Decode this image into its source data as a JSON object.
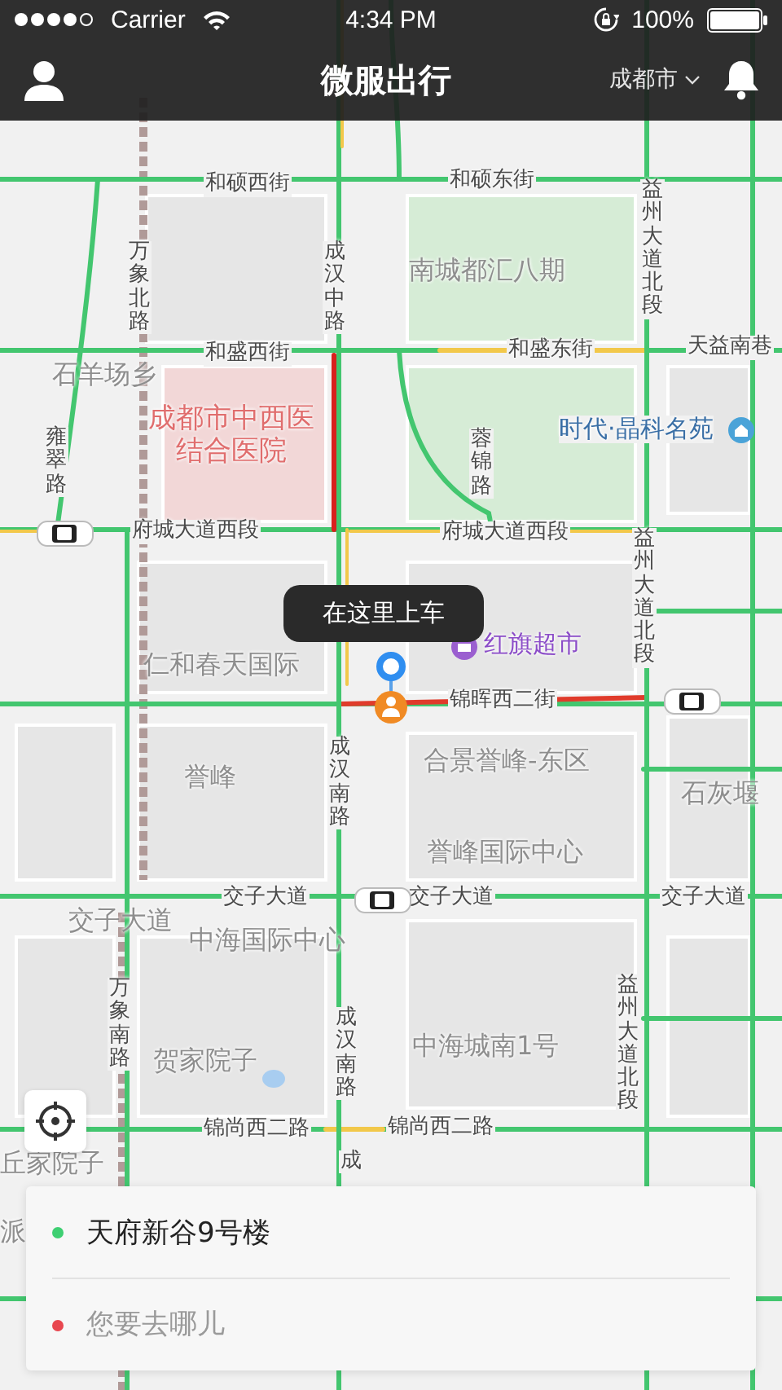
{
  "status_bar": {
    "carrier": "Carrier",
    "time": "4:34 PM",
    "battery": "100%"
  },
  "nav": {
    "title": "微服出行",
    "city": "成都市"
  },
  "map": {
    "labels": [
      {
        "text": "和硕西街",
        "kind": "road",
        "vertical": false
      },
      {
        "text": "和硕东街",
        "kind": "road",
        "vertical": false
      },
      {
        "text": "南城都汇八期",
        "kind": "area",
        "vertical": false
      },
      {
        "text": "和盛西街",
        "kind": "road",
        "vertical": false
      },
      {
        "text": "和盛东街",
        "kind": "road",
        "vertical": false
      },
      {
        "text": "天益南巷",
        "kind": "road",
        "vertical": false
      },
      {
        "text": "石羊场乡",
        "kind": "area",
        "vertical": false
      },
      {
        "text": "成都市中西医结合医院",
        "kind": "hospital",
        "vertical": false
      },
      {
        "text": "时代·晶科名苑",
        "kind": "poi",
        "vertical": false
      },
      {
        "text": "府城大道西段",
        "kind": "road",
        "vertical": false
      },
      {
        "text": "府城大道西段",
        "kind": "road",
        "vertical": false
      },
      {
        "text": "红旗超市",
        "kind": "shop",
        "vertical": false
      },
      {
        "text": "仁和春天国际",
        "kind": "area",
        "vertical": false
      },
      {
        "text": "锦晖西二街",
        "kind": "road",
        "vertical": false
      },
      {
        "text": "合景誉峰-东区",
        "kind": "area",
        "vertical": false
      },
      {
        "text": "誉峰",
        "kind": "area",
        "vertical": false
      },
      {
        "text": "石灰堰",
        "kind": "area",
        "vertical": false
      },
      {
        "text": "誉峰国际中心",
        "kind": "area",
        "vertical": false
      },
      {
        "text": "交子大道",
        "kind": "road",
        "vertical": false
      },
      {
        "text": "交子大道",
        "kind": "road",
        "vertical": false
      },
      {
        "text": "交子大道",
        "kind": "road",
        "vertical": false
      },
      {
        "text": "交子大道",
        "kind": "area",
        "vertical": false
      },
      {
        "text": "中海国际中心",
        "kind": "area",
        "vertical": false
      },
      {
        "text": "中海城南1号",
        "kind": "area",
        "vertical": false
      },
      {
        "text": "贺家院子",
        "kind": "area",
        "vertical": false
      },
      {
        "text": "锦尚西二路",
        "kind": "road",
        "vertical": false
      },
      {
        "text": "锦尚西二路",
        "kind": "road",
        "vertical": false
      },
      {
        "text": "丘家院子",
        "kind": "area",
        "vertical": false
      },
      {
        "text": "派",
        "kind": "area",
        "vertical": false
      },
      {
        "text": "万象北路",
        "kind": "road",
        "vertical": true
      },
      {
        "text": "成汉中路",
        "kind": "road",
        "vertical": true
      },
      {
        "text": "益州大道北段",
        "kind": "road",
        "vertical": true
      },
      {
        "text": "雍翠路",
        "kind": "road",
        "vertical": true
      },
      {
        "text": "蓉锦路",
        "kind": "road",
        "vertical": true
      },
      {
        "text": "益州大道北段",
        "kind": "road",
        "vertical": true
      },
      {
        "text": "成汉南路",
        "kind": "road",
        "vertical": true
      },
      {
        "text": "万象南路",
        "kind": "road",
        "vertical": true
      },
      {
        "text": "成汉南路",
        "kind": "road",
        "vertical": true
      },
      {
        "text": "益州大道北段",
        "kind": "road",
        "vertical": true
      },
      {
        "text": "成",
        "kind": "road",
        "vertical": true
      }
    ]
  },
  "pickup_tooltip": "在这里上车",
  "route_card": {
    "rows": [
      {
        "value": "天府新谷9号楼",
        "color": "#3ecf72"
      },
      {
        "placeholder": "您要去哪儿",
        "color": "#e8474f"
      }
    ]
  }
}
